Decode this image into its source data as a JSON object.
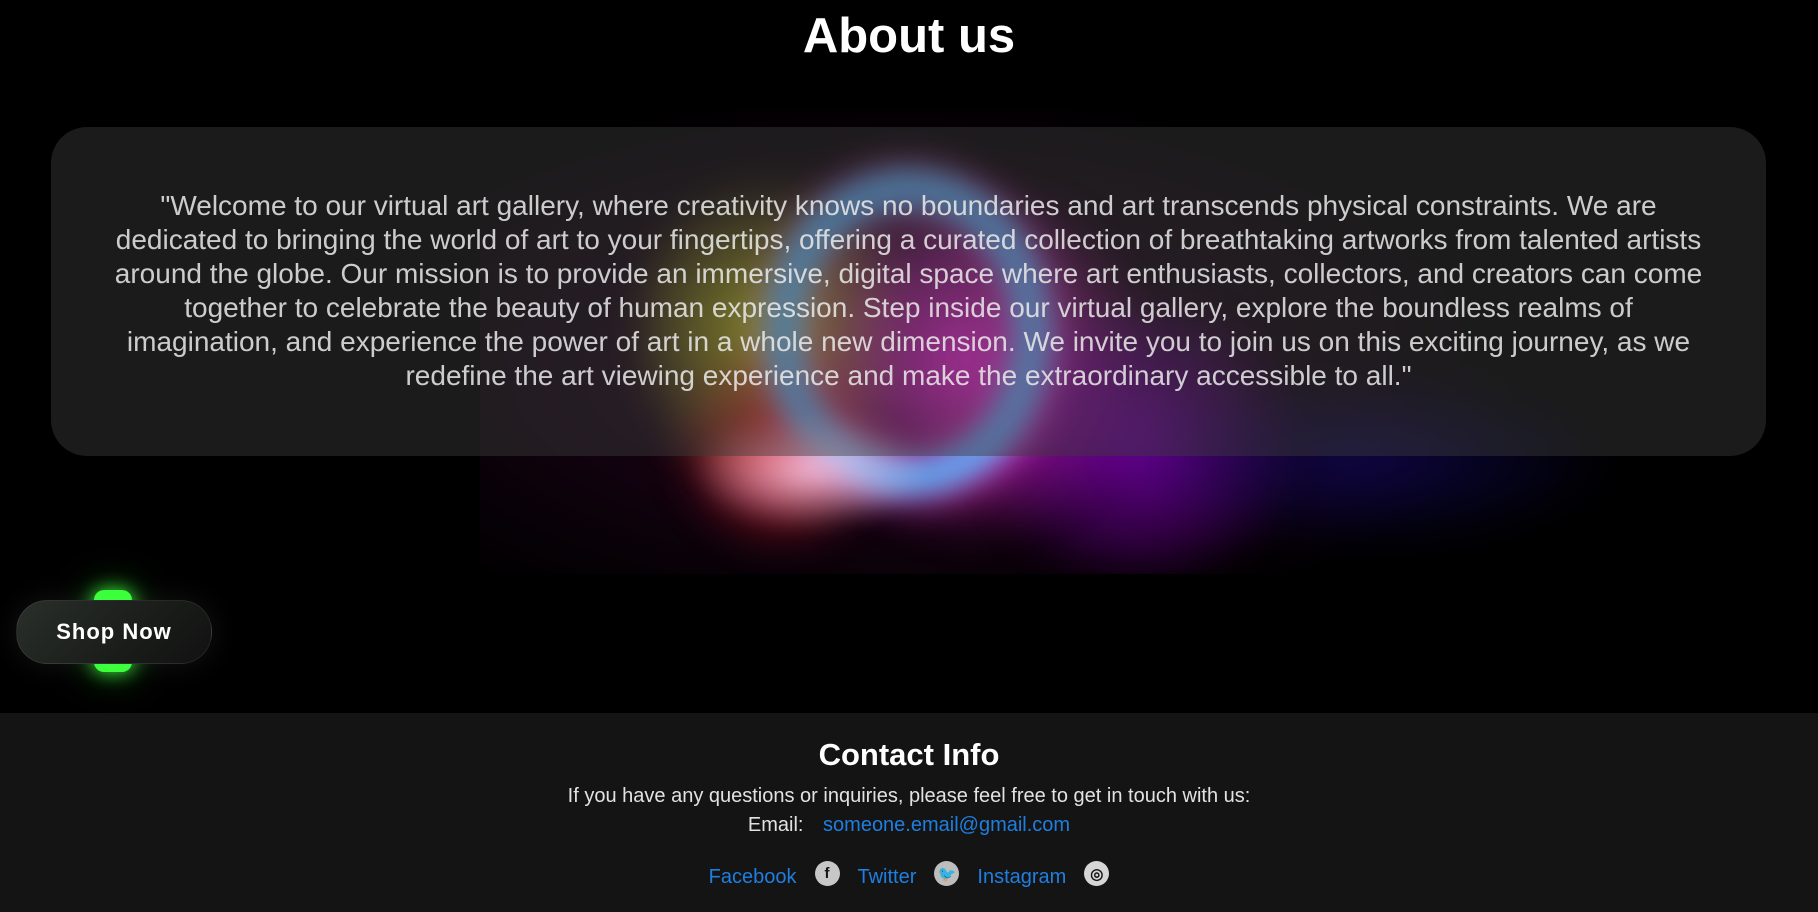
{
  "about": {
    "title": "About us",
    "body": "\"Welcome to our virtual art gallery, where creativity knows no boundaries and art transcends physical constraints. We are dedicated to bringing the world of art to your fingertips, offering a curated collection of breathtaking artworks from talented artists around the globe. Our mission is to provide an immersive, digital space where art enthusiasts, collectors, and creators can come together to celebrate the beauty of human expression. Step inside our virtual gallery, explore the boundless realms of imagination, and experience the power of art in a whole new dimension. We invite you to join us on this exciting journey, as we redefine the art viewing experience and make the extraordinary accessible to all.\""
  },
  "shop": {
    "label": "Shop Now",
    "accent": "#37ff37"
  },
  "contact": {
    "title": "Contact Info",
    "intro": "If you have any questions or inquiries, please feel free to get in touch with us:",
    "email_label": "Email:",
    "email": "someone.email@gmail.com",
    "link_color": "#1f7fe0"
  },
  "social": [
    {
      "label": "Facebook",
      "icon": "facebook-icon",
      "glyph": "f"
    },
    {
      "label": "Twitter",
      "icon": "twitter-icon",
      "glyph": "🐦"
    },
    {
      "label": "Instagram",
      "icon": "instagram-icon",
      "glyph": "◎"
    }
  ]
}
